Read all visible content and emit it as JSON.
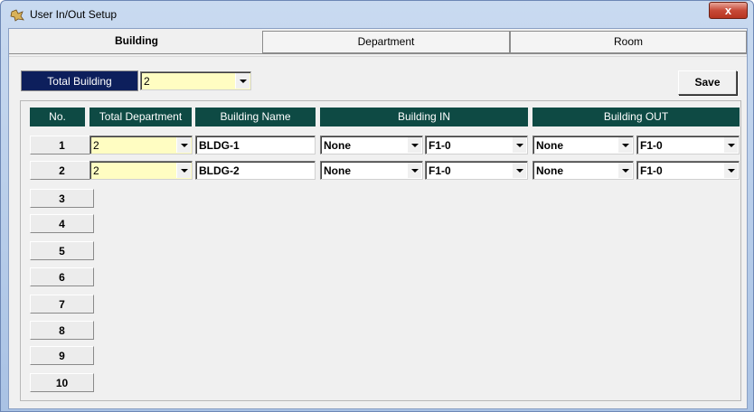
{
  "window": {
    "title": "User In/Out Setup",
    "close_label": "x"
  },
  "tabs": [
    {
      "label": "Building"
    },
    {
      "label": "Department"
    },
    {
      "label": "Room"
    }
  ],
  "toolbar": {
    "total_building_label": "Total Building",
    "total_building_value": "2",
    "save_label": "Save"
  },
  "table": {
    "headers": {
      "no": "No.",
      "total_department": "Total Department",
      "building_name": "Building Name",
      "building_in": "Building IN",
      "building_out": "Building OUT"
    },
    "row_numbers": [
      "1",
      "2",
      "3",
      "4",
      "5",
      "6",
      "7",
      "8",
      "9",
      "10"
    ],
    "rows": [
      {
        "total_department": "2",
        "building_name": "BLDG-1",
        "in_building": "None",
        "in_floor": "F1-0",
        "out_building": "None",
        "out_floor": "F1-0"
      },
      {
        "total_department": "2",
        "building_name": "BLDG-2",
        "in_building": "None",
        "in_floor": "F1-0",
        "out_building": "None",
        "out_floor": "F1-0"
      }
    ]
  },
  "colors": {
    "label_navy": "#0d1f5c",
    "header_teal": "#0e4a44",
    "combo_yellow": "#fffdc2"
  }
}
